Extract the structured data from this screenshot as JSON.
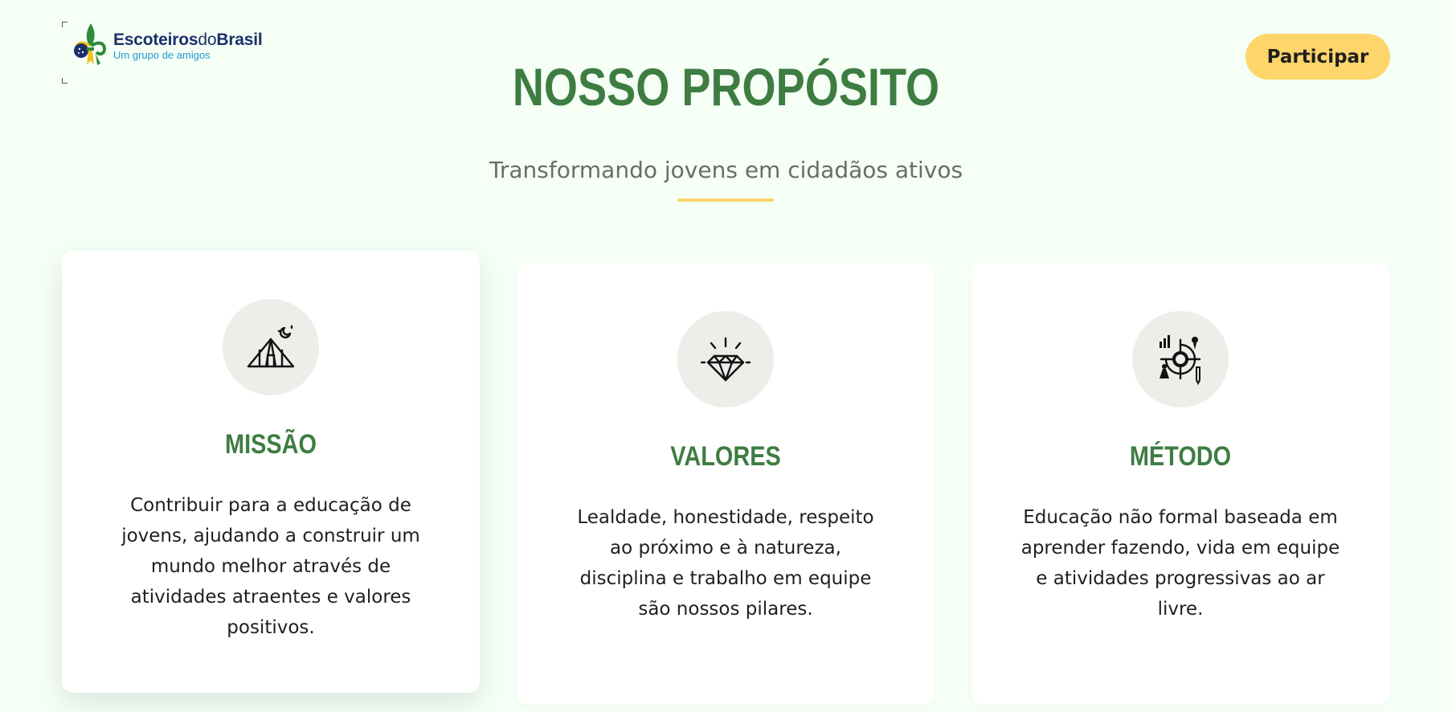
{
  "header": {
    "logo": {
      "name_bold_1": "Escoteiros",
      "name_light": "do",
      "name_bold_2": "Brasil",
      "tagline": "Um grupo de amigos"
    },
    "cta_label": "Participar"
  },
  "section": {
    "title": "NOSSO PROPÓSITO",
    "subtitle": "Transformando jovens em cidadãos ativos"
  },
  "cards": [
    {
      "icon": "tent-icon",
      "title": "MISSÃO",
      "text": "Contribuir para a educação de jovens, ajudando a construir um mundo melhor através de atividades atraentes e valores positivos."
    },
    {
      "icon": "diamond-icon",
      "title": "VALORES",
      "text": "Lealdade, honestidade, respeito ao próximo e à natureza, disciplina e trabalho em equipe são nossos pilares."
    },
    {
      "icon": "method-icon",
      "title": "MÉTODO",
      "text": "Educação não formal baseada em aprender fazendo, vida em equipe e atividades progressivas ao ar livre."
    }
  ],
  "colors": {
    "background": "#f5fff5",
    "brand_green": "#3e7d42",
    "accent_yellow": "#fdd56a",
    "logo_navy": "#1d2f6b",
    "logo_blue": "#1f9ad3"
  }
}
